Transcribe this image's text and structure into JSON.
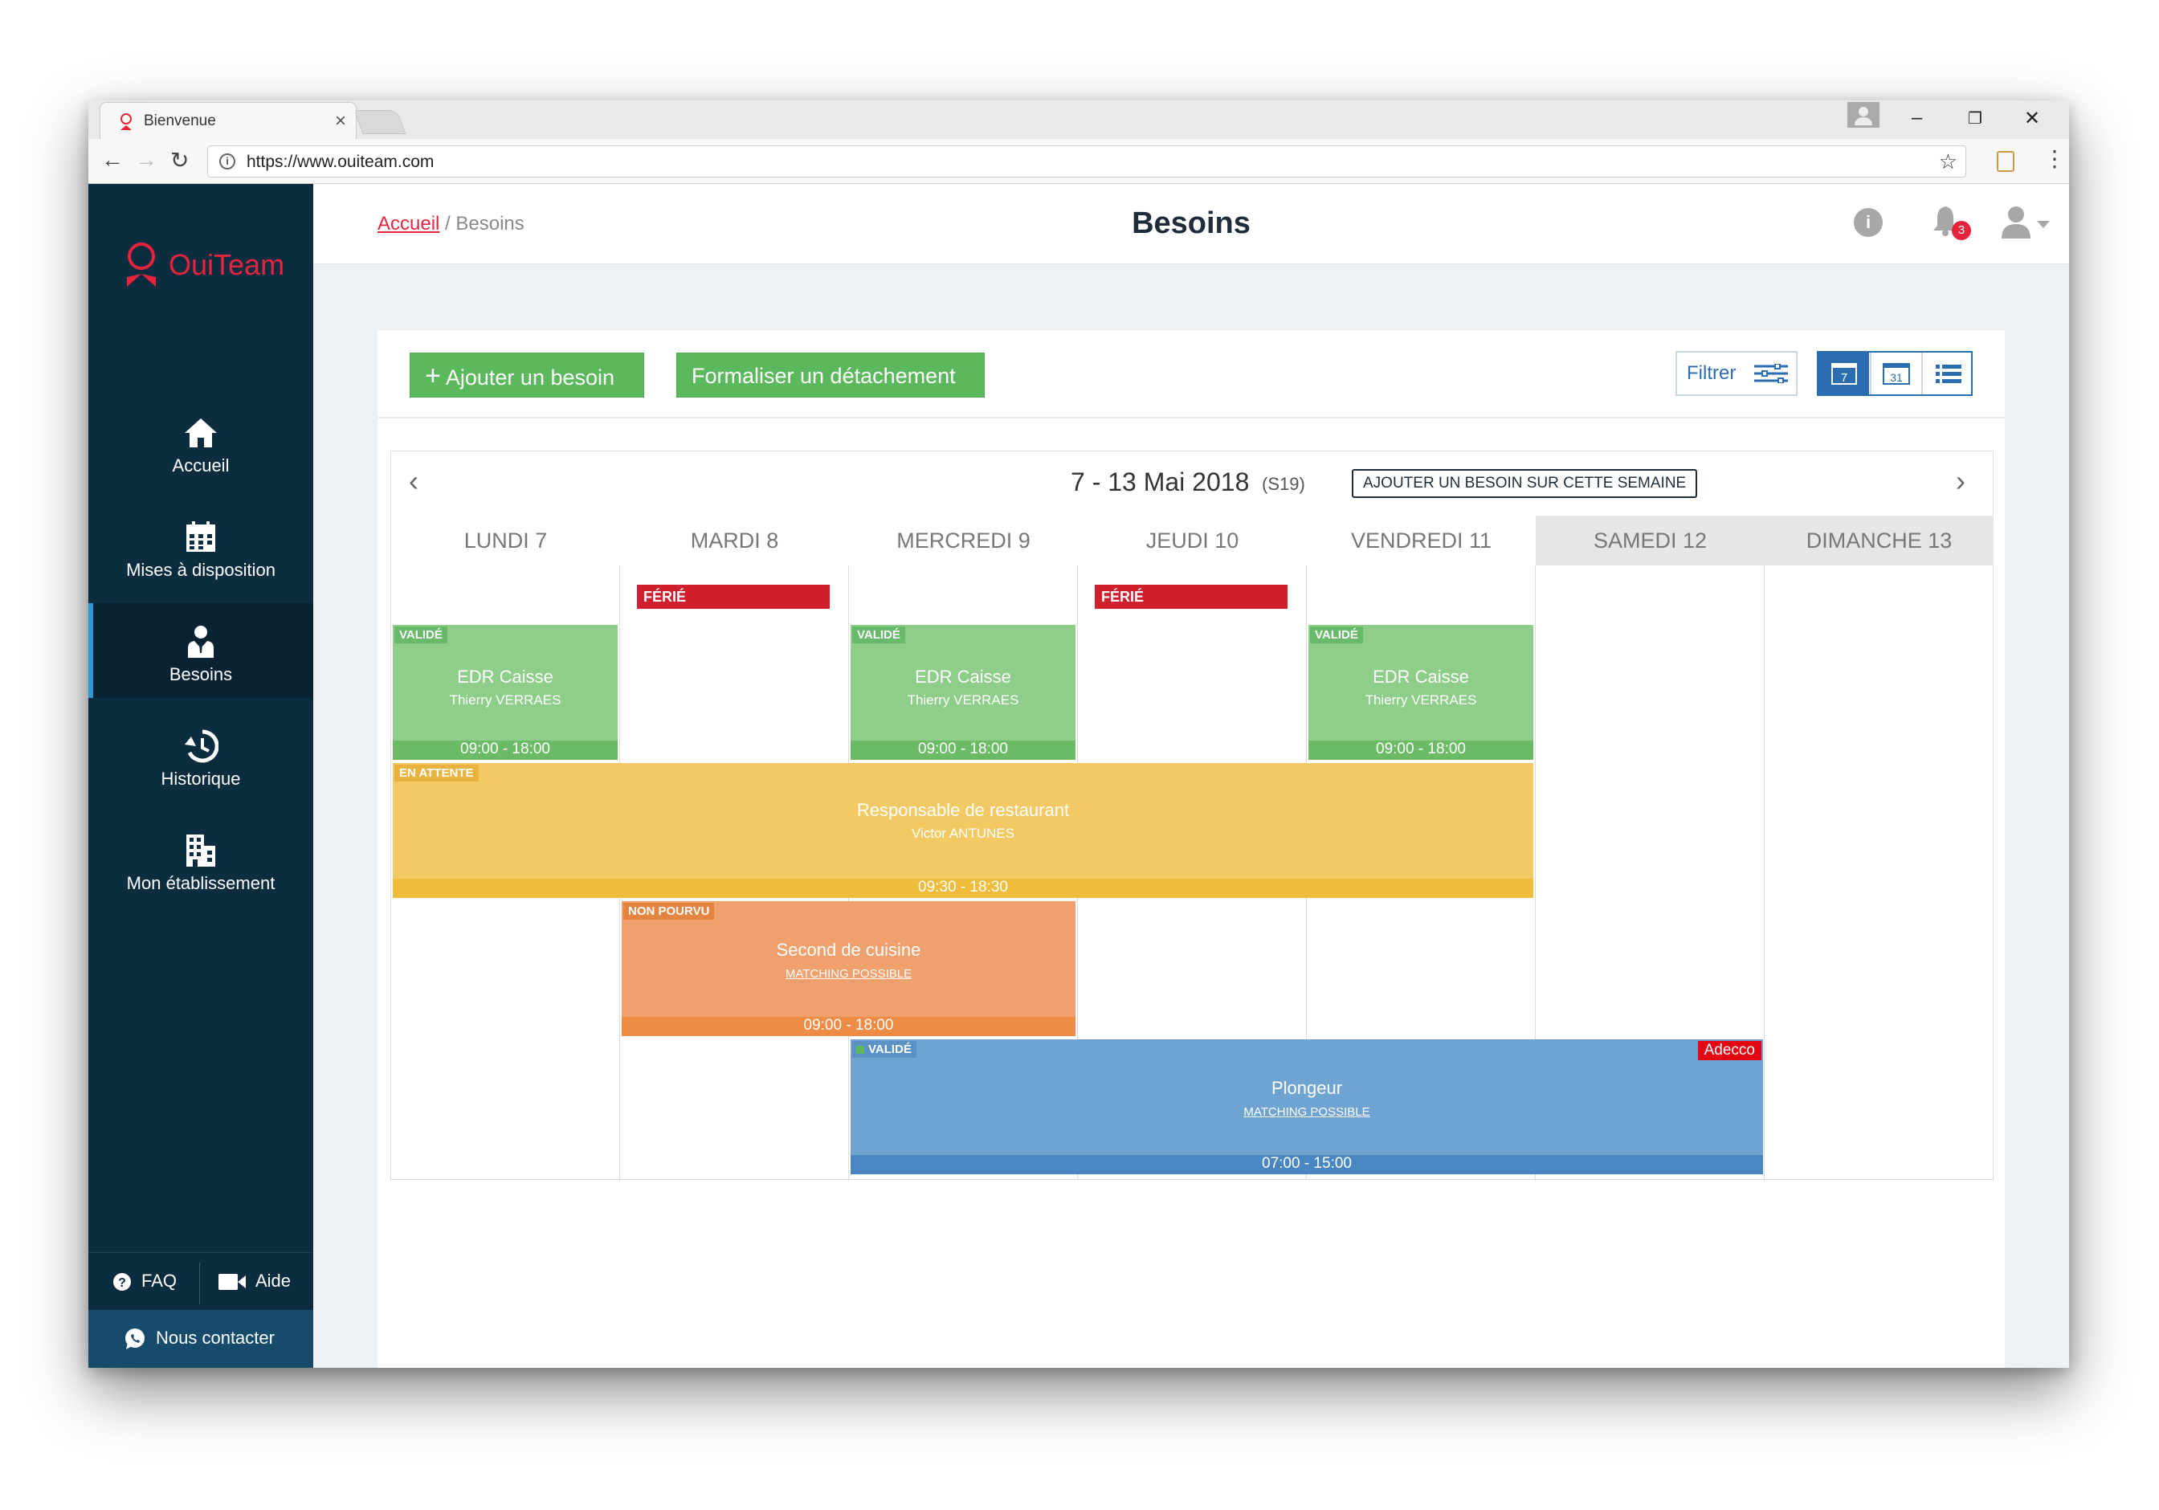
{
  "browser": {
    "tab_title": "Bienvenue",
    "tab_close": "×",
    "url": "https://www.ouiteam.com",
    "controls": {
      "minimize": "–",
      "restore": "❐",
      "close": "✕"
    }
  },
  "sidebar": {
    "brand": "OuiTeam",
    "items": [
      {
        "label": "Accueil",
        "icon": "home-icon"
      },
      {
        "label": "Mises à disposition",
        "icon": "calendar-icon"
      },
      {
        "label": "Besoins",
        "icon": "worker-icon",
        "active": true
      },
      {
        "label": "Historique",
        "icon": "history-icon"
      },
      {
        "label": "Mon établissement",
        "icon": "building-icon"
      }
    ],
    "faq_label": "FAQ",
    "aide_label": "Aide",
    "contact_label": "Nous contacter"
  },
  "header": {
    "breadcrumb_home": "Accueil",
    "breadcrumb_sep": "/",
    "breadcrumb_current": "Besoins",
    "title": "Besoins",
    "notification_count": "3"
  },
  "toolbar": {
    "add_label": "Ajouter un besoin",
    "add_plus": "+",
    "detach_label": "Formaliser un détachement",
    "filter_label": "Filtrer",
    "view_week_num": "7",
    "view_month_num": "31"
  },
  "calendar": {
    "range": "7 - 13 Mai 2018",
    "week": "(S19)",
    "add_week_label": "AJOUTER UN BESOIN SUR CETTE SEMAINE",
    "prev": "‹",
    "next": "›",
    "days": [
      "LUNDI 7",
      "MARDI 8",
      "MERCREDI 9",
      "JEUDI 10",
      "VENDREDI 11",
      "SAMEDI 12",
      "DIMANCHE 13"
    ],
    "holiday_label": "FÉRIÉ",
    "events": {
      "edr_mon": {
        "status": "VALIDÉ",
        "title": "EDR Caisse",
        "person": "Thierry VERRAES",
        "time": "09:00 - 18:00"
      },
      "edr_wed": {
        "status": "VALIDÉ",
        "title": "EDR Caisse",
        "person": "Thierry VERRAES",
        "time": "09:00 - 18:00"
      },
      "edr_fri": {
        "status": "VALIDÉ",
        "title": "EDR Caisse",
        "person": "Thierry VERRAES",
        "time": "09:00 - 18:00"
      },
      "resp": {
        "status": "EN ATTENTE",
        "title": "Responsable de restaurant",
        "person": "Victor ANTUNES",
        "time": "09:30 - 18:30"
      },
      "second": {
        "status": "NON POURVU",
        "title": "Second de cuisine",
        "link": "MATCHING POSSIBLE",
        "time": "09:00 - 18:00"
      },
      "plongeur": {
        "status": "VALIDÉ",
        "title": "Plongeur",
        "link": "MATCHING POSSIBLE",
        "time": "07:00 - 15:00",
        "agency": "Adecco"
      }
    }
  },
  "colors": {
    "sidebar": "#0c2c3f",
    "brand_red": "#e8243c",
    "validated": "#8fcd8a",
    "pending": "#f3c964",
    "unfilled": "#f0a06c",
    "blue_event": "#6fa3d2"
  }
}
